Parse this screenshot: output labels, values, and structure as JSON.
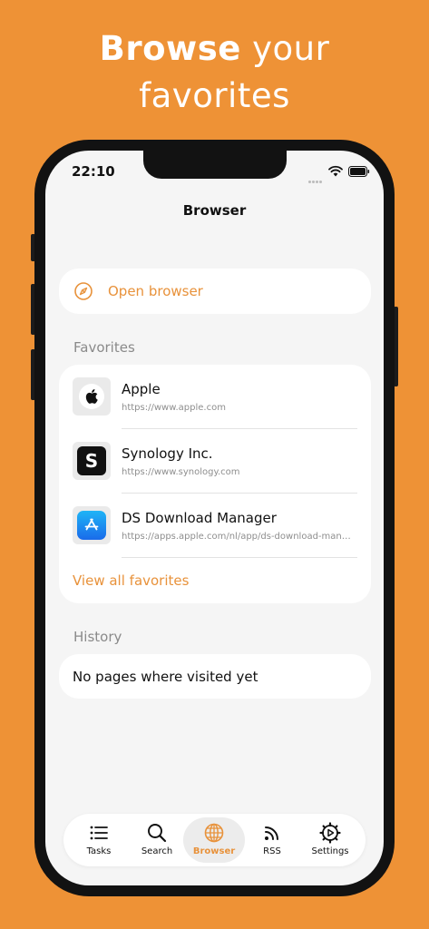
{
  "headline": {
    "bold": "Browse",
    "rest": "your",
    "line2": "favorites"
  },
  "status": {
    "time": "22:10"
  },
  "nav": {
    "title": "Browser"
  },
  "open_browser": {
    "label": "Open browser",
    "icon": "compass-icon"
  },
  "favorites": {
    "header": "Favorites",
    "items": [
      {
        "name": "Apple",
        "url": "https://www.apple.com",
        "icon": "apple-logo-icon"
      },
      {
        "name": "Synology Inc.",
        "url": "https://www.synology.com",
        "icon": "synology-s-icon"
      },
      {
        "name": "DS Download Manager",
        "url": "https://apps.apple.com/nl/app/ds-download-manager",
        "icon": "app-store-icon"
      }
    ],
    "view_all": "View all favorites"
  },
  "history": {
    "header": "History",
    "empty_text": "No pages where visited yet"
  },
  "tabbar": {
    "tabs": [
      {
        "label": "Tasks",
        "icon": "list-icon",
        "active": false
      },
      {
        "label": "Search",
        "icon": "magnifier-icon",
        "active": false
      },
      {
        "label": "Browser",
        "icon": "globe-icon",
        "active": true
      },
      {
        "label": "RSS",
        "icon": "rss-icon",
        "active": false
      },
      {
        "label": "Settings",
        "icon": "gear-icon",
        "active": false
      }
    ]
  },
  "colors": {
    "background": "#EE9236",
    "accent": "#E8923B",
    "screen": "#F5F5F5"
  }
}
